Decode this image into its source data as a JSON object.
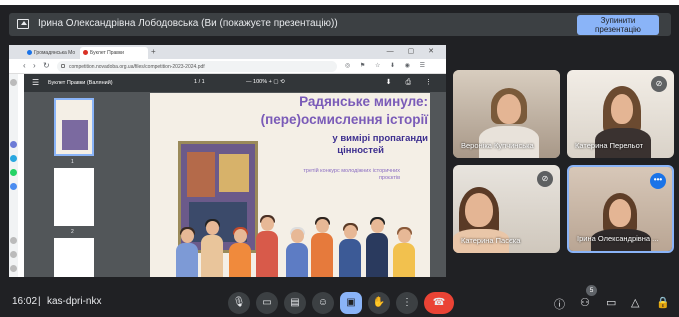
{
  "presenting": {
    "banner": "Ірина Олександрівна Лободовська (Ви (покажуєте презентацію))",
    "stop_button": "Зупинити презентацію"
  },
  "browser": {
    "tabs": [
      {
        "label": "Громадянська Мо"
      },
      {
        "label": "Буклет Правки"
      }
    ],
    "url": "competition.novadoba.org.ua/files/competition-2023-2024.pdf"
  },
  "pdf": {
    "filename": "Буклет Правки (Валяний)",
    "page_current": "1",
    "page_total": "1",
    "zoom": "100%",
    "thumb_numbers": [
      "1",
      "2",
      "3"
    ],
    "title_line1": "Радянське минуле:",
    "title_line2": "(пере)осмислення історії",
    "title_line3": "у вимірі пропаганди",
    "title_line4": "цінностей",
    "subtitle": "третій конкурс молодіжних історичних проєктів"
  },
  "participants": [
    {
      "name": "Вероніка Купчинська",
      "muted": false
    },
    {
      "name": "Катерина Перельот",
      "muted": true
    },
    {
      "name": "Катерина Пасєка",
      "muted": true
    },
    {
      "name": "Ірина Олександрівна ...",
      "muted": false
    }
  ],
  "bottom": {
    "time": "16:02",
    "separator": "|",
    "meeting_code": "kas-dpri-nkx",
    "people_count": "5"
  },
  "colors": {
    "meet_bg": "#202124",
    "accent": "#8ab4f8",
    "end_call": "#ea4335",
    "page_title": "#7a5bb8"
  },
  "icons": [
    "present-icon",
    "mic-icon",
    "camera-icon",
    "captions-icon",
    "emoji-icon",
    "present-now-icon",
    "raise-hand-icon",
    "more-icon",
    "end-call-icon",
    "info-icon",
    "people-icon",
    "chat-icon",
    "activities-icon",
    "host-controls-icon"
  ]
}
